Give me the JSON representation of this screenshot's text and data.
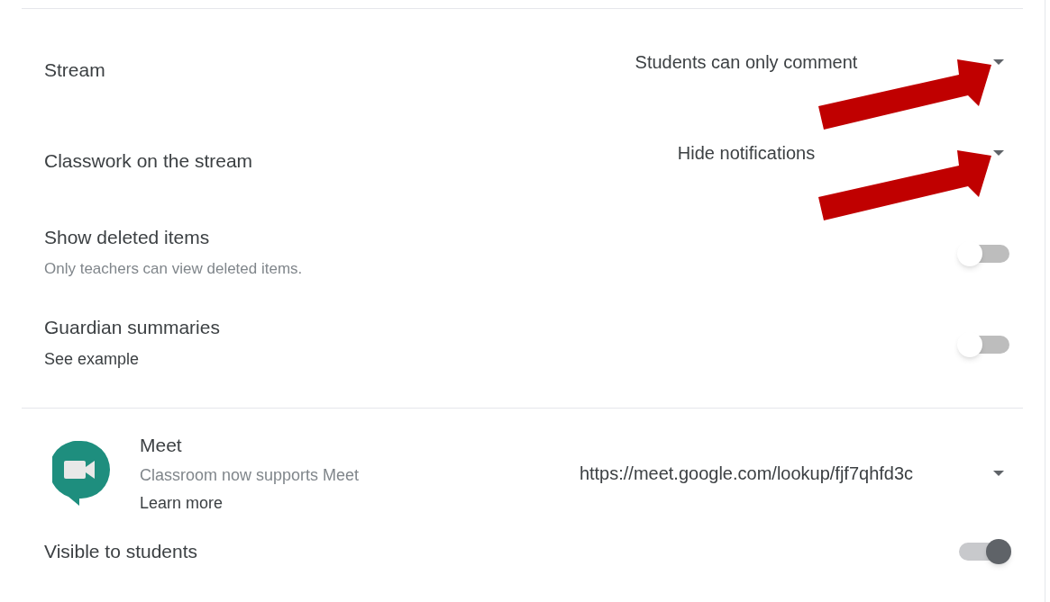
{
  "settings": [
    {
      "kind": "dropdown",
      "label": "Stream",
      "value": "Students can only comment",
      "highlighted": true
    },
    {
      "kind": "dropdown",
      "label": "Classwork on the stream",
      "value": "Hide notifications",
      "highlighted": true
    },
    {
      "kind": "toggle",
      "label": "Show deleted items",
      "description": "Only teachers can view deleted items.",
      "on": false
    },
    {
      "kind": "toggle",
      "label": "Guardian summaries",
      "link": "See example",
      "on": false
    }
  ],
  "meet": {
    "title": "Meet",
    "description": "Classroom now supports Meet",
    "link": "Learn more",
    "url": "https://meet.google.com/lookup/fjf7qhfd3c",
    "visible_label": "Visible to students",
    "visible_on": true
  }
}
